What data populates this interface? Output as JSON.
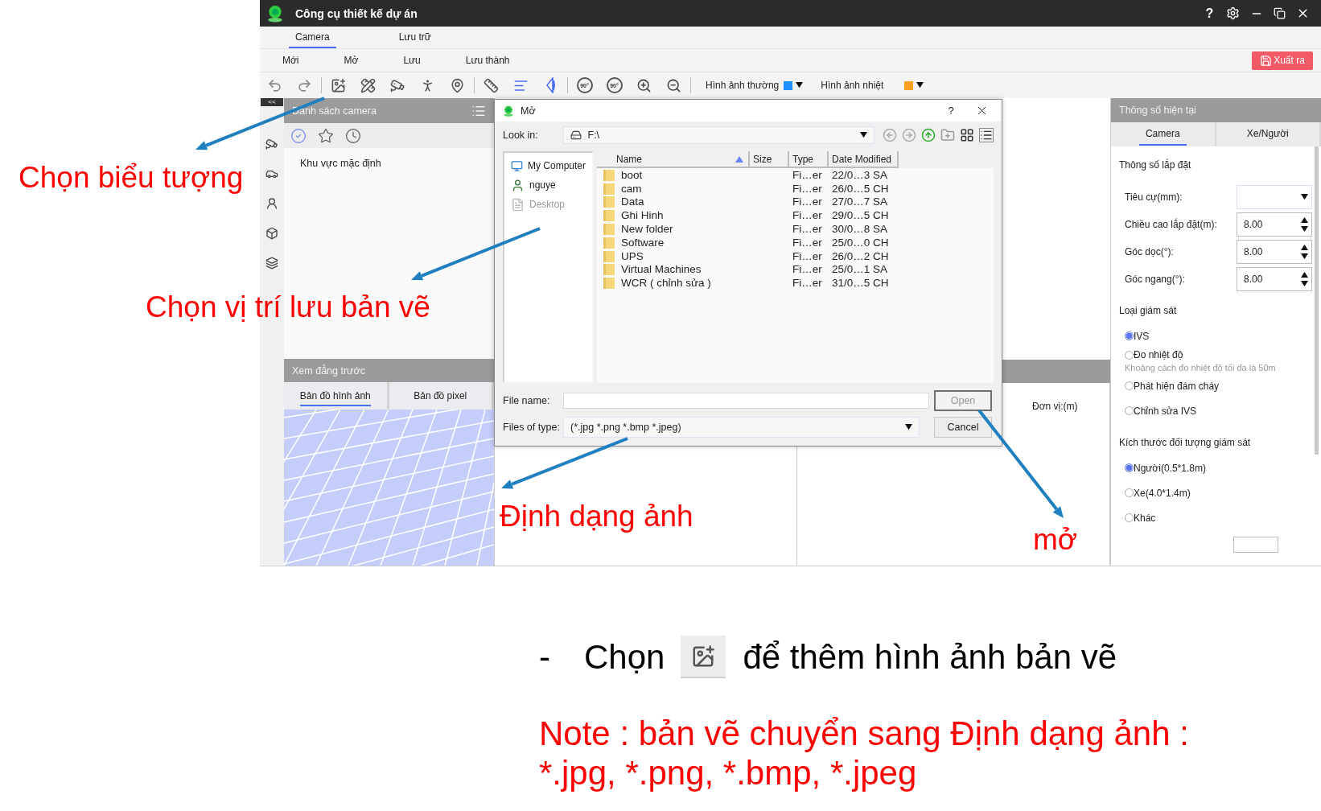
{
  "app": {
    "title": "Công cụ thiết kế dự án",
    "help": "?",
    "tabs": [
      {
        "label": "Camera",
        "selected": true
      },
      {
        "label": "Lưu trữ",
        "selected": false
      }
    ],
    "menu": [
      "Mới",
      "Mở",
      "Lưu",
      "Lưu thành"
    ],
    "export_button": "Xuất ra",
    "toolbar": {
      "rotate_labels": [
        "90°",
        "90°"
      ],
      "image_modes": [
        {
          "label": "Hình ảnh thường",
          "color": "#1e90ff"
        },
        {
          "label": "Hình ảnh nhiệt",
          "color": "#ffa020"
        }
      ]
    },
    "collapse_button": "<<",
    "camera_list": {
      "title": "Danh sách camera",
      "filters": [
        {
          "selected": true
        },
        {
          "selected": false
        },
        {
          "selected": false
        }
      ],
      "items": [
        "Khu vực mặc định"
      ]
    },
    "preview": {
      "title": "Xem đẳng trước",
      "tabs": [
        {
          "label": "Bản đồ hình ảnh",
          "selected": true
        },
        {
          "label": "Bản đồ pixel",
          "selected": false
        }
      ]
    },
    "canvas": {
      "unit_label": "Đơn vị:(m)"
    },
    "params": {
      "title": "Thông số hiện tại",
      "tabs": [
        {
          "label": "Camera",
          "selected": true
        },
        {
          "label": "Xe/Người",
          "selected": false
        }
      ],
      "sections": [
        {
          "kind": "fields",
          "title": "Thông số lắp đặt",
          "fields": [
            {
              "kind": "select",
              "label": "Tiêu cự(mm):"
            },
            {
              "kind": "spinner",
              "label": "Chiều cao lắp đặt(m):",
              "value": "8.00"
            },
            {
              "kind": "spinner",
              "label": "Góc dọc(°):",
              "value": "8.00"
            },
            {
              "kind": "spinner",
              "label": "Góc ngang(°):",
              "value": "8.00"
            }
          ]
        },
        {
          "kind": "radios",
          "title": "Loại giám sát",
          "options": [
            {
              "label": "IVS",
              "selected": true
            },
            {
              "label": "Đo nhiệt độ",
              "selected": false,
              "note": "Khoảng cách đo nhiệt độ tối đa là 50m"
            },
            {
              "label": "Phát hiện đám cháy",
              "selected": false
            },
            {
              "label": "Chỉnh sửa IVS",
              "selected": false
            }
          ]
        },
        {
          "kind": "radios",
          "title": "Kích thước đối tượng giám sát",
          "options": [
            {
              "label": "Người(0.5*1.8m)",
              "selected": true
            },
            {
              "label": "Xe(4.0*1.4m)",
              "selected": false
            },
            {
              "label": "Khác",
              "selected": false
            }
          ]
        }
      ]
    }
  },
  "dialog": {
    "title": "Mở",
    "help": "?",
    "look_in_label": "Look in:",
    "look_in": "F:\\",
    "places": [
      {
        "label": "My Computer",
        "dimmed": false
      },
      {
        "label": "nguye",
        "dimmed": false
      },
      {
        "label": "Desktop",
        "dimmed": true
      }
    ],
    "columns": [
      "Name",
      "Size",
      "Type",
      "Date Modified"
    ],
    "files": [
      {
        "name": "boot",
        "type": "Fi…er",
        "modified": "22/0…3 SA"
      },
      {
        "name": "cam",
        "type": "Fi…er",
        "modified": "26/0…5 CH"
      },
      {
        "name": "Data",
        "type": "Fi…er",
        "modified": "27/0…7 SA"
      },
      {
        "name": "Ghi Hinh",
        "type": "Fi…er",
        "modified": "29/0…5 CH"
      },
      {
        "name": "New folder",
        "type": "Fi…er",
        "modified": "30/0…8 SA"
      },
      {
        "name": "Software",
        "type": "Fi…er",
        "modified": "25/0…0 CH"
      },
      {
        "name": "UPS",
        "type": "Fi…er",
        "modified": "26/0…2 CH"
      },
      {
        "name": "Virtual Machines",
        "type": "Fi…er",
        "modified": "25/0…1 SA"
      },
      {
        "name": "WCR ( chỉnh sửa )",
        "type": "Fi…er",
        "modified": "31/0…5 CH"
      }
    ],
    "file_name_label": "File name:",
    "file_type_label": "Files of type:",
    "file_type": "(*.jpg *.png *.bmp *.jpeg)",
    "buttons": [
      {
        "label": "Open",
        "disabled": true
      },
      {
        "label": "Cancel",
        "disabled": false
      }
    ]
  },
  "callouts": [
    "Chọn biểu tượng",
    "Chọn vị trí lưu bản vẽ",
    "Định dạng ảnh",
    "mở"
  ],
  "instruction": {
    "bullet": "-",
    "before": "Chọn",
    "after": "để thêm hình ảnh bản vẽ"
  },
  "note": "Note : bản vẽ chuyển sang Định dạng ảnh : *.jpg, *.png, *.bmp, *.jpeg"
}
